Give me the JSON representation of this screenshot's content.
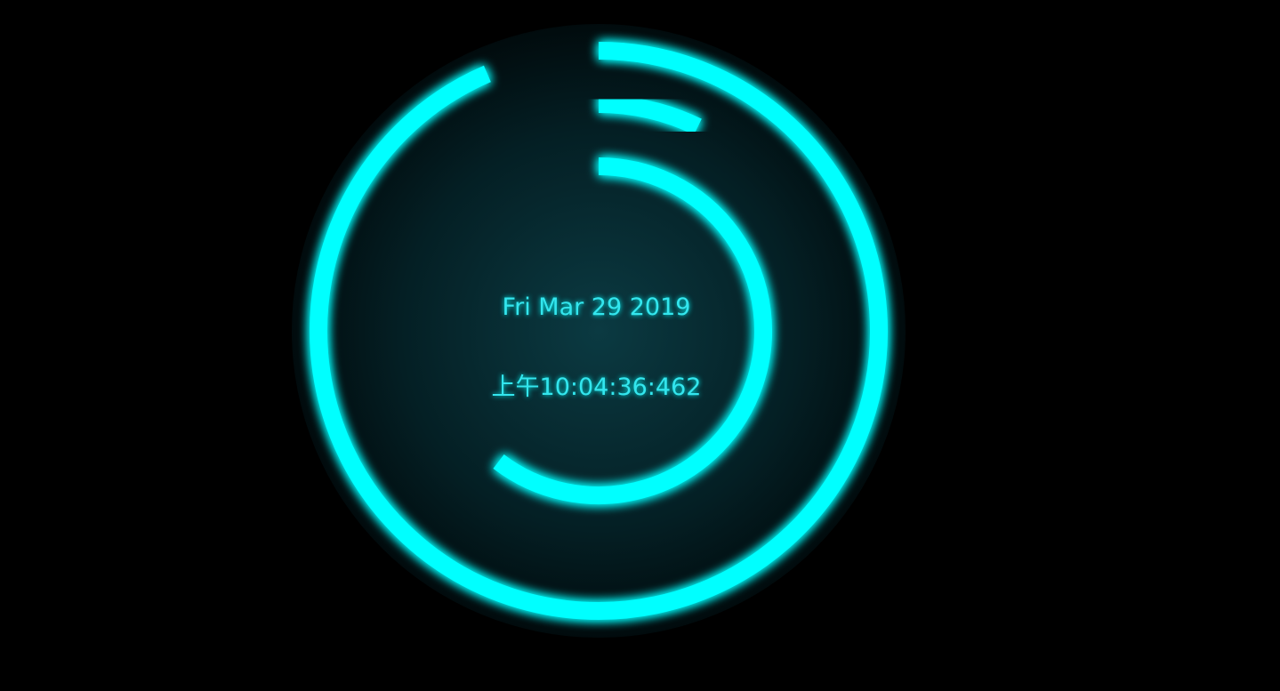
{
  "clock": {
    "date": "Fri Mar 29 2019",
    "time": "上午10:04:36:462",
    "rings": [
      {
        "name": "outer-ring",
        "progress": 0.935
      },
      {
        "name": "middle-ring",
        "progress": 0.072
      },
      {
        "name": "inner-ring",
        "progress": 0.604
      }
    ]
  },
  "colors": {
    "background": "#000000",
    "face": "#04262c",
    "accent": "#00ffff",
    "text": "#33e6ee"
  }
}
